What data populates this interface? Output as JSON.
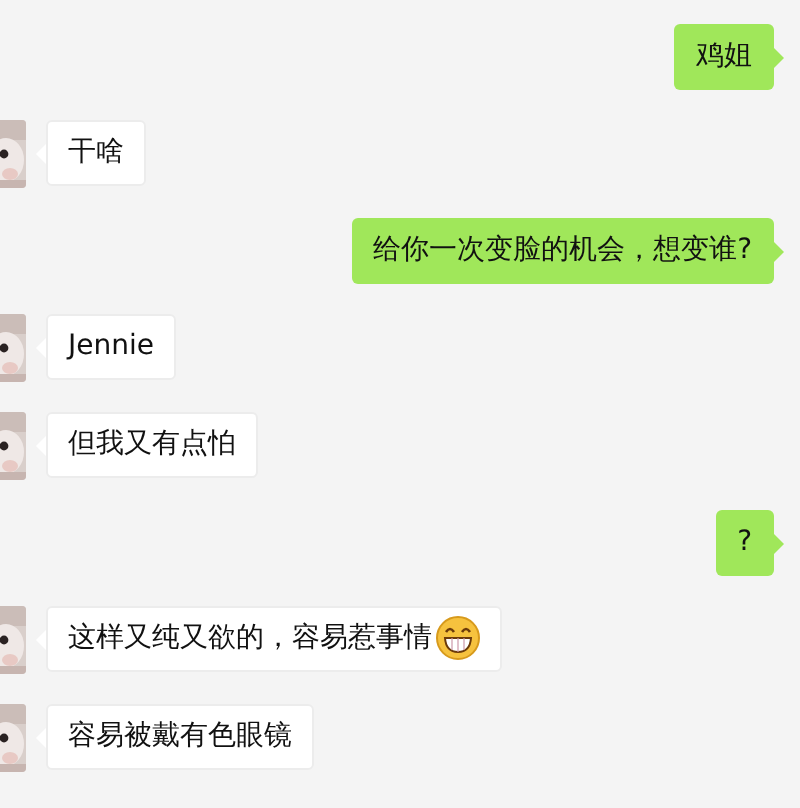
{
  "messages": [
    {
      "kind": "sent",
      "text": "鸡姐",
      "emoji": false
    },
    {
      "kind": "received",
      "text": "干啥",
      "emoji": false
    },
    {
      "kind": "sent",
      "text": "给你一次变脸的机会，想变谁?",
      "emoji": false
    },
    {
      "kind": "received",
      "text": "Jennie",
      "emoji": false
    },
    {
      "kind": "received",
      "text": "但我又有点怕",
      "emoji": false
    },
    {
      "kind": "sent",
      "text": "?",
      "emoji": false
    },
    {
      "kind": "received",
      "text": "这样又纯又欲的，容易惹事情",
      "emoji": true
    },
    {
      "kind": "received",
      "text": "容易被戴有色眼镜",
      "emoji": false
    }
  ]
}
